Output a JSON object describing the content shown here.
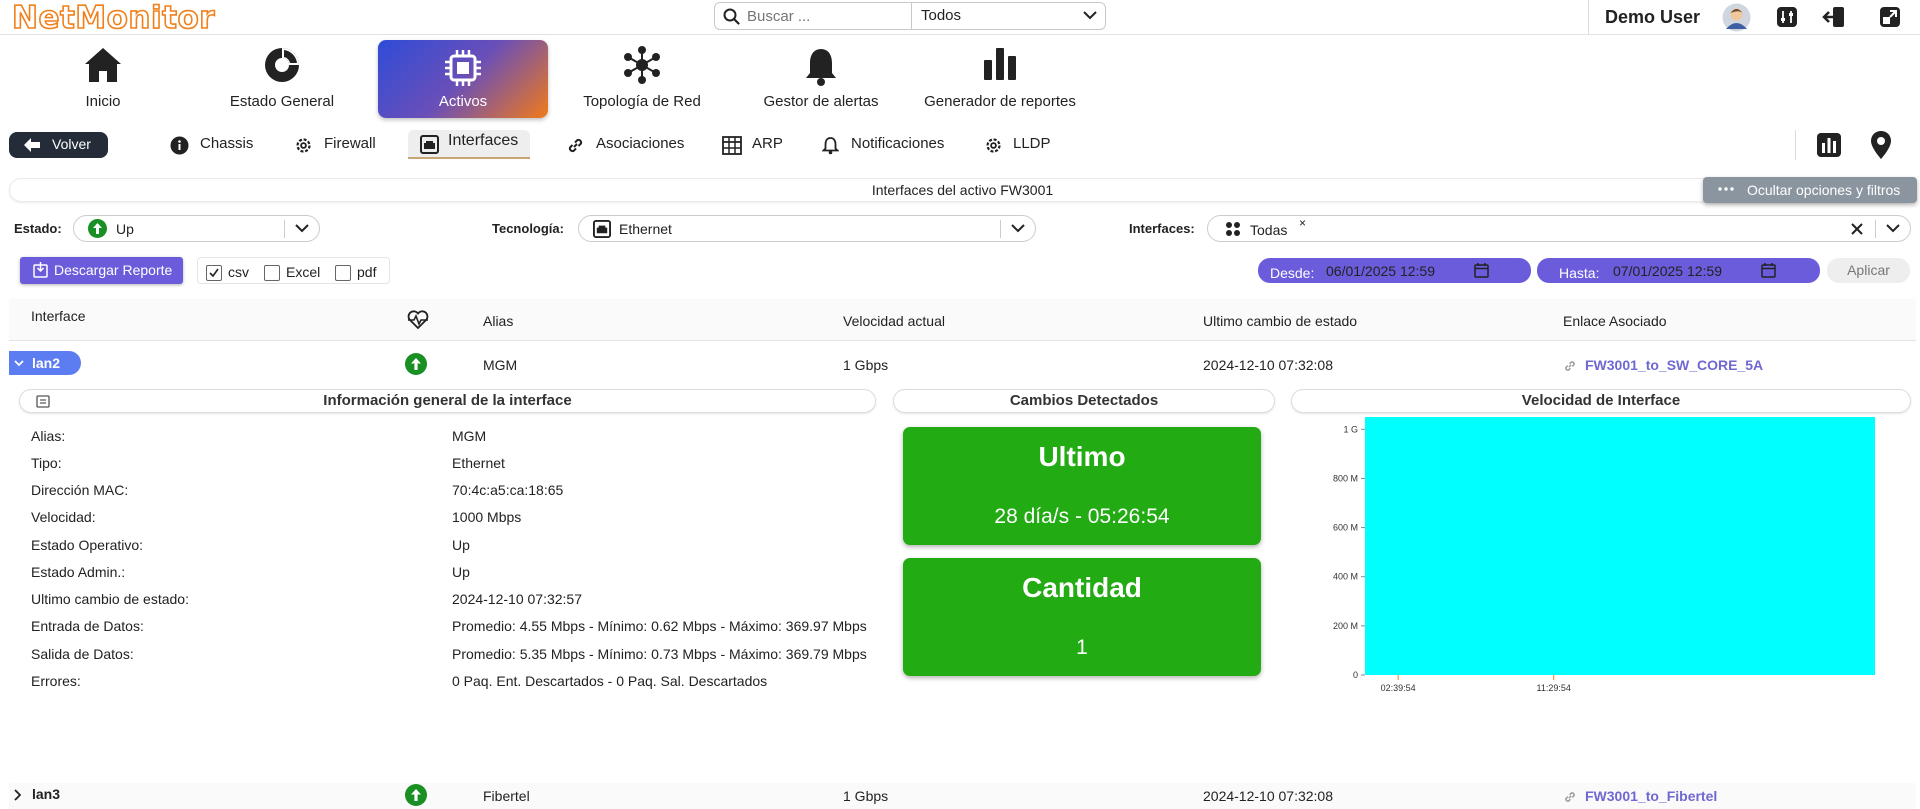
{
  "app": {
    "name": "NetMonitor"
  },
  "search": {
    "placeholder": "Buscar ...",
    "scope": "Todos"
  },
  "user": {
    "name": "Demo User"
  },
  "nav": [
    {
      "label": "Inicio",
      "icon": "home-icon"
    },
    {
      "label": "Estado General",
      "icon": "gauge-icon"
    },
    {
      "label": "Activos",
      "icon": "chip-icon"
    },
    {
      "label": "Topología de Red",
      "icon": "topology-icon"
    },
    {
      "label": "Gestor de alertas",
      "icon": "bell-icon"
    },
    {
      "label": "Generador de reportes",
      "icon": "bar-chart-icon"
    }
  ],
  "subnav": {
    "back_label": "Volver",
    "tabs": [
      {
        "label": "Chassis",
        "icon": "info-icon"
      },
      {
        "label": "Firewall",
        "icon": "gear-icon"
      },
      {
        "label": "Interfaces",
        "icon": "ethernet-icon"
      },
      {
        "label": "Asociaciones",
        "icon": "link-icon"
      },
      {
        "label": "ARP",
        "icon": "table-icon"
      },
      {
        "label": "Notificaciones",
        "icon": "bell-icon"
      },
      {
        "label": "LLDP",
        "icon": "gear-icon"
      }
    ]
  },
  "page": {
    "title": "Interfaces del activo FW3001",
    "hide_options_label": "Ocultar opciones y filtros"
  },
  "filters": {
    "estado_label": "Estado:",
    "estado_value": "Up",
    "tecnologia_label": "Tecnología:",
    "tecnologia_value": "Ethernet",
    "interfaces_label": "Interfaces:",
    "interfaces_value": "Todas",
    "interfaces_remove": "×"
  },
  "report": {
    "download_label": "Descargar Reporte",
    "formats": [
      {
        "label": "csv",
        "checked": true
      },
      {
        "label": "Excel",
        "checked": false
      },
      {
        "label": "pdf",
        "checked": false
      }
    ],
    "from_label": "Desde:",
    "from_value": "06/01/2025 12:59",
    "to_label": "Hasta:",
    "to_value": "07/01/2025 12:59",
    "apply_label": "Aplicar"
  },
  "table": {
    "headers": {
      "interface": "Interface",
      "alias": "Alias",
      "speed": "Velocidad actual",
      "last_change": "Ultimo cambio de estado",
      "link": "Enlace Asociado"
    },
    "rows": [
      {
        "interface": "lan2",
        "status": "up",
        "alias": "MGM",
        "speed": "1 Gbps",
        "last_change": "2024-12-10 07:32:08",
        "link": "FW3001_to_SW_CORE_5A"
      },
      {
        "interface": "lan3",
        "status": "up",
        "alias": "Fibertel",
        "speed": "1 Gbps",
        "last_change": "2024-12-10 07:32:08",
        "link": "FW3001_to_Fibertel"
      }
    ]
  },
  "detail": {
    "info_title": "Información general de la interface",
    "changes_title": "Cambios Detectados",
    "speed_title": "Velocidad de Interface",
    "info": [
      {
        "label": "Alias:",
        "value": "MGM"
      },
      {
        "label": "Tipo:",
        "value": "Ethernet"
      },
      {
        "label": "Dirección MAC:",
        "value": "70:4c:a5:ca:18:65"
      },
      {
        "label": "Velocidad:",
        "value": "1000 Mbps"
      },
      {
        "label": "Estado Operativo:",
        "value": "Up"
      },
      {
        "label": "Estado Admin.:",
        "value": "Up"
      },
      {
        "label": "Ultimo cambio de estado:",
        "value": "2024-12-10 07:32:57"
      },
      {
        "label": "Entrada de Datos:",
        "value": "Promedio: 4.55 Mbps - Mínimo: 0.62 Mbps - Máximo: 369.97 Mbps"
      },
      {
        "label": "Salida de Datos:",
        "value": "Promedio: 5.35 Mbps - Mínimo: 0.73 Mbps - Máximo: 369.79 Mbps"
      },
      {
        "label": "Errores:",
        "value": "0 Paq. Ent. Descartados - 0 Paq. Sal. Descartados"
      }
    ],
    "last_card": {
      "title": "Ultimo",
      "value": "28 día/s - 05:26:54"
    },
    "count_card": {
      "title": "Cantidad",
      "value": "1"
    }
  },
  "colors": {
    "brand_orange": "#f0801c",
    "accent_purple": "#6b5cdb",
    "status_green": "#22ab12",
    "chart_fill": "#00ffff",
    "link": "#6f68d2"
  },
  "chart_data": {
    "type": "area",
    "title": "Velocidad de Interface",
    "xlabel": "",
    "ylabel": "",
    "yticks": [
      "0",
      "200 M",
      "400 M",
      "600 M",
      "800 M",
      "1 G"
    ],
    "ytick_values": [
      0,
      200,
      400,
      600,
      800,
      1000
    ],
    "xticks": [
      "02:39:54",
      "11:29:54"
    ],
    "ylim": [
      0,
      1050
    ],
    "series": [
      {
        "values": [
          1050,
          1050
        ],
        "color": "#00ffff"
      }
    ],
    "grid": false
  }
}
